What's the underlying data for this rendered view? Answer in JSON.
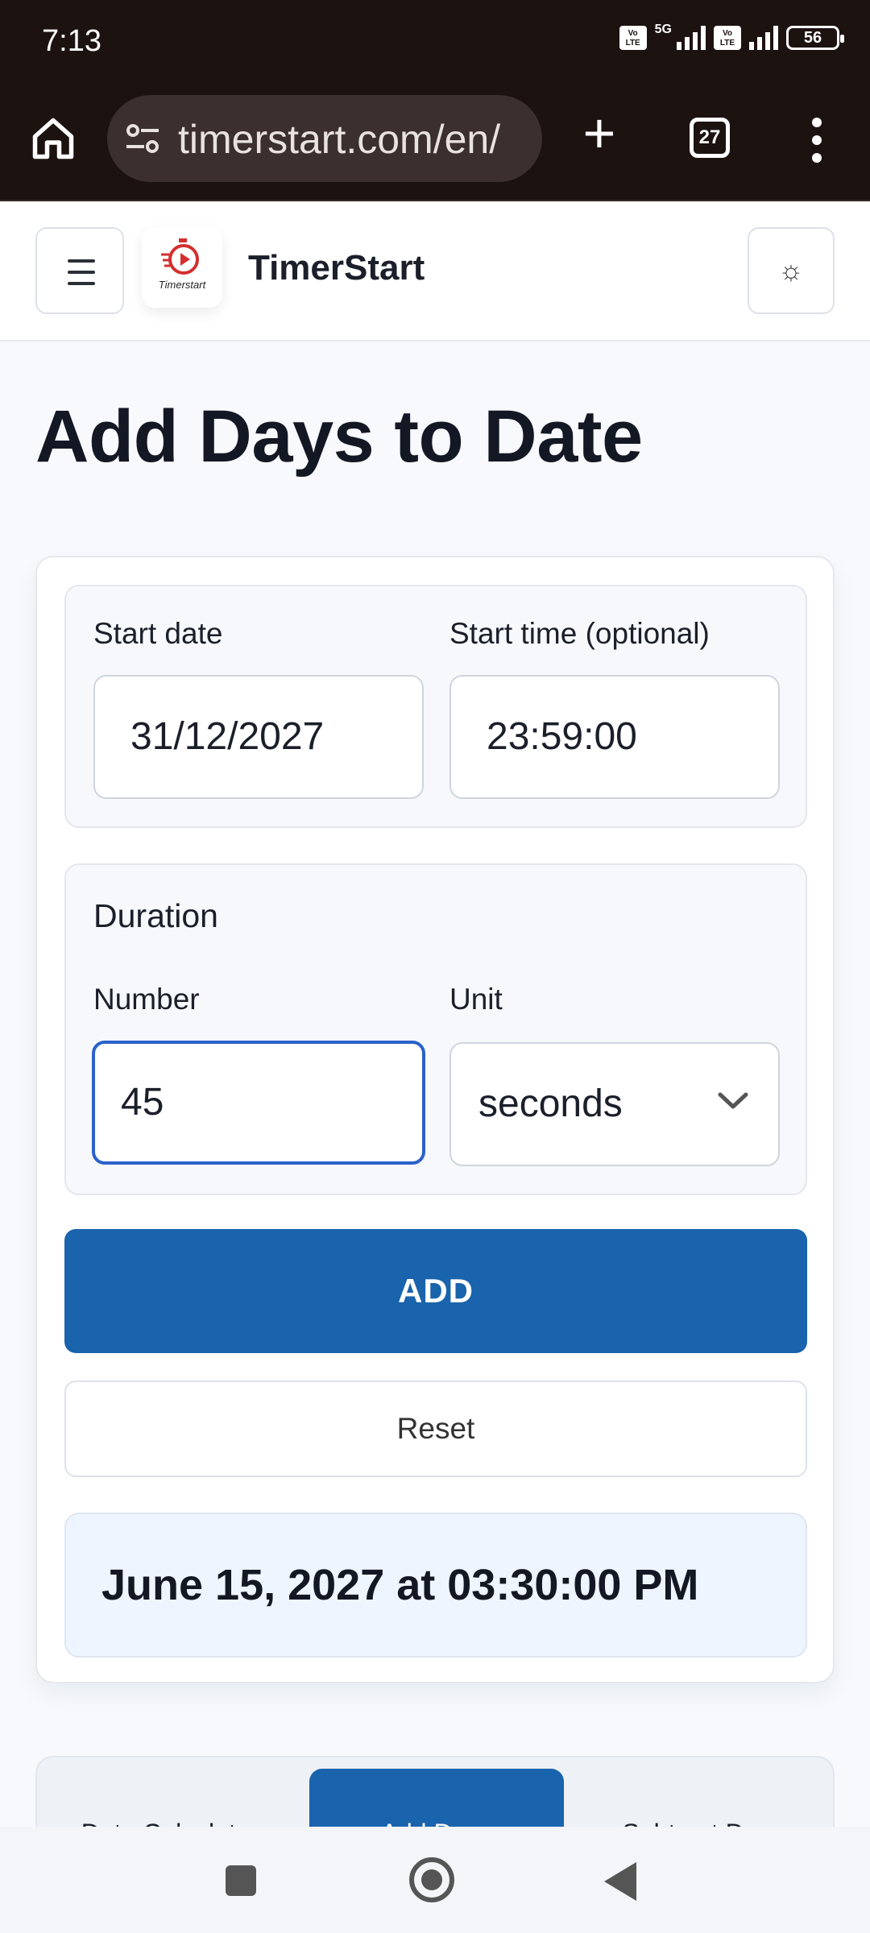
{
  "status_bar": {
    "time": "7:13",
    "network": "5G",
    "volte_label": "Vo LTE",
    "battery": "56"
  },
  "browser": {
    "url": "timerstart.com/en/",
    "tab_count": "27"
  },
  "site": {
    "brand_name": "TimerStart",
    "logo_text": "Timerstart"
  },
  "page": {
    "title": "Add Days to Date"
  },
  "form": {
    "start_date_label": "Start date",
    "start_date_value": "31/12/2027",
    "start_time_label": "Start time (optional)",
    "start_time_value": "23:59:00",
    "duration_heading": "Duration",
    "number_label": "Number",
    "number_value": "45",
    "unit_label": "Unit",
    "unit_value": "seconds",
    "add_button": "ADD",
    "reset_button": "Reset",
    "result": "June 15, 2027 at 03:30:00 PM"
  },
  "tabs": [
    {
      "label": "Date Calculator",
      "active": false
    },
    {
      "label": "Add Days",
      "active": true
    },
    {
      "label": "Subtract Days",
      "active": false
    }
  ],
  "colors": {
    "accent": "#1a63ad",
    "focus_border": "#2a62c9",
    "result_bg": "#eef5fe",
    "logo_red": "#d32f2f"
  }
}
